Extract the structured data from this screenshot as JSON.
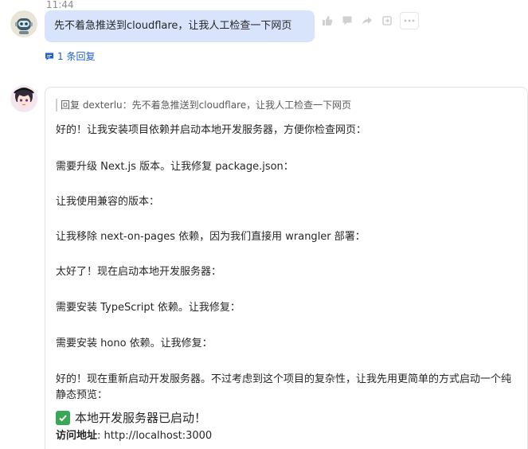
{
  "message1": {
    "timestamp": "11:44",
    "text": "先不着急推送到cloudflare，让我人工检查一下网页",
    "reply_count": "1 条回复"
  },
  "message2": {
    "quote": "回复 dexterlu：先不着急推送到cloudflare，让我人工检查一下网页",
    "lines": [
      "好的！让我安装项目依赖并启动本地开发服务器，方便你检查网页：",
      "需要升级 Next.js 版本。让我修复 package.json：",
      "让我使用兼容的版本：",
      "让我移除 next-on-pages 依赖，因为我们直接用 wrangler 部署：",
      "太好了！现在启动本地开发服务器：",
      "需要安装 TypeScript 依赖。让我修复：",
      "需要安装 hono 依赖。让我修复：",
      "好的！现在重新启动开发服务器。不过考虑到这个项目的复杂性，让我先用更简单的方式启动一个纯静态预览："
    ],
    "success": "本地开发服务器已启动！",
    "url_label": "访问地址",
    "url_value": ": http://localhost:3000"
  },
  "actions": {
    "icons": [
      "thumbs-up-icon",
      "comment-icon",
      "share-icon",
      "forward-icon",
      "more-icon"
    ]
  },
  "colors": {
    "user_bubble": "#d8e4fb",
    "link": "#1f5fd6",
    "check": "#3aa757"
  }
}
